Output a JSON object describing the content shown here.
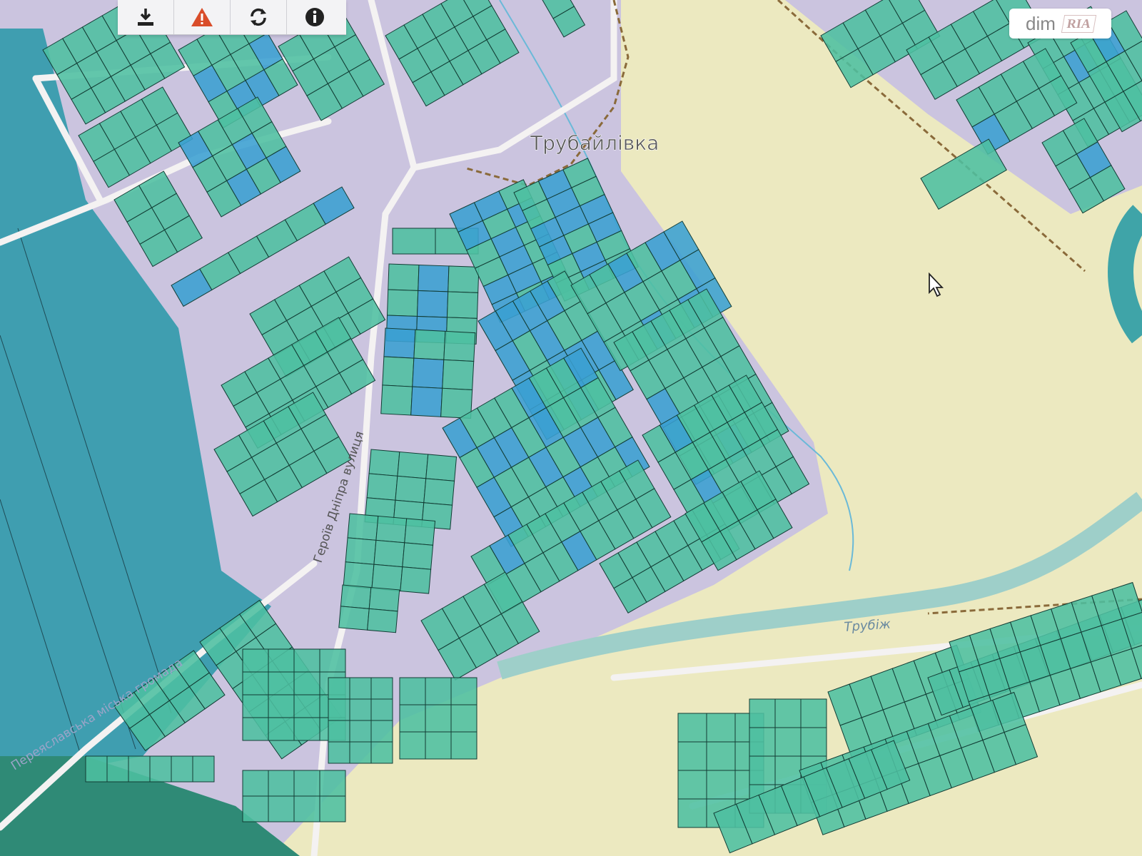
{
  "toolbar": {
    "tools": [
      {
        "icon": "download-icon"
      },
      {
        "icon": "warning-icon"
      },
      {
        "icon": "refresh-icon"
      },
      {
        "icon": "info-icon"
      }
    ]
  },
  "map": {
    "place_label": "Трубайлівка",
    "street_label": "Героїв Дніпра вулиця",
    "river_label": "Трубіж",
    "community_label": "Переяславська міська громада"
  },
  "watermark": {
    "dim": "dim",
    "ria": "RIA"
  },
  "colors": {
    "water": "#3f92b4",
    "field": "#ece9c0",
    "settlement": "#cbc4df",
    "parcel": "#4dbfa1",
    "parcel_blue": "#3a9fd2",
    "road": "#f4f2f2"
  }
}
